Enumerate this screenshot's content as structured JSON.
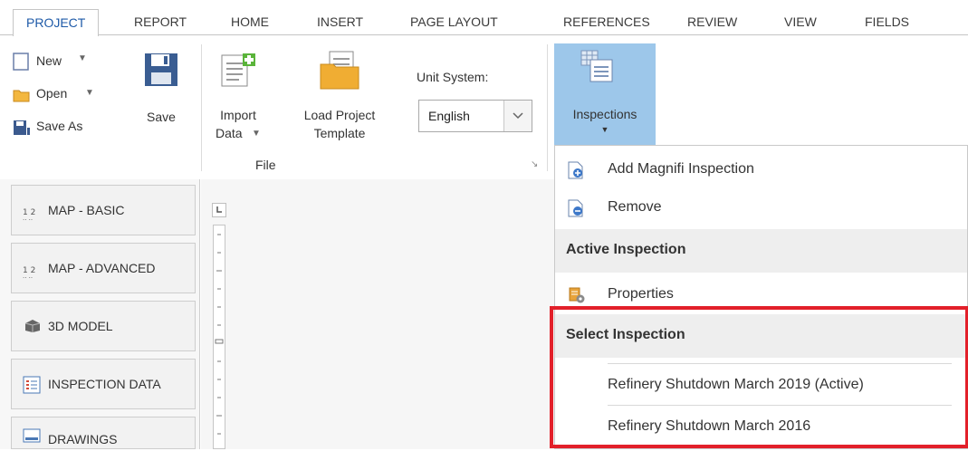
{
  "tabs": [
    "PROJECT",
    "REPORT",
    "HOME",
    "INSERT",
    "PAGE LAYOUT",
    "REFERENCES",
    "REVIEW",
    "VIEW",
    "FIELDS"
  ],
  "ribbon": {
    "new_label": "New",
    "open_label": "Open",
    "save_as_label": "Save As",
    "save_label": "Save",
    "import_label_1": "Import",
    "import_label_2": "Data",
    "load_template_1": "Load Project",
    "load_template_2": "Template",
    "unit_system_label": "Unit System:",
    "unit_system_value": "English",
    "file_group_label": "File",
    "inspections_label": "Inspections"
  },
  "sidebar": {
    "items": [
      "MAP - BASIC",
      "MAP - ADVANCED",
      "3D MODEL",
      "INSPECTION DATA",
      "DRAWINGS"
    ]
  },
  "menu": {
    "add_label": "Add Magnifi Inspection",
    "remove_label": "Remove",
    "active_header": "Active Inspection",
    "properties_label": "Properties",
    "select_header": "Select Inspection",
    "options": [
      "Refinery Shutdown March 2019 (Active)",
      "Refinery Shutdown March 2016"
    ]
  },
  "colors": {
    "active_tab": "#1e5aa8",
    "inspections_button_bg": "#9dc7ea",
    "highlight_border": "#e2202a"
  }
}
